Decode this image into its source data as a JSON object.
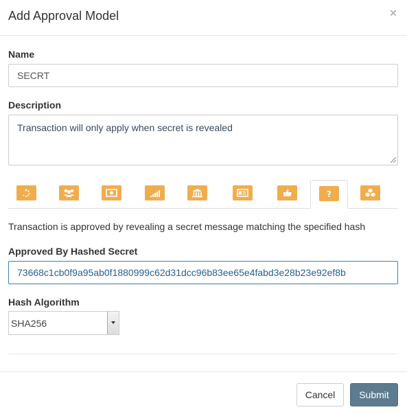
{
  "modal": {
    "title": "Add Approval Model",
    "close_glyph": "×"
  },
  "form": {
    "name_label": "Name",
    "name_value": "SECRT",
    "description_label": "Description",
    "description_value": "Transaction will only apply when secret is revealed",
    "approval_tabs": [
      {
        "icon": "spinner-icon",
        "active": false
      },
      {
        "icon": "users-icon",
        "active": false
      },
      {
        "icon": "money-icon",
        "active": false
      },
      {
        "icon": "signal-icon",
        "active": false
      },
      {
        "icon": "bank-icon",
        "active": false
      },
      {
        "icon": "id-card-icon",
        "active": false
      },
      {
        "icon": "thumbs-up-icon",
        "active": false
      },
      {
        "icon": "question-icon",
        "active": true
      },
      {
        "icon": "cubes-icon",
        "active": false
      }
    ],
    "tab_description": "Transaction is approved by revealing a secret message matching the specified hash",
    "hashed_secret_label": "Approved By Hashed Secret",
    "hashed_secret_value": "73668c1cb0f9a95ab0f1880999c62d31dcc96b83ee65e4fabd3e28b23e92ef8b",
    "hash_algorithm_label": "Hash Algorithm",
    "hash_algorithm_value": "SHA256"
  },
  "footer": {
    "cancel_label": "Cancel",
    "submit_label": "Submit"
  },
  "colors": {
    "tab_orange": "#f0ad4e",
    "submit_bg": "#5d7b8f",
    "focus_border": "#3b7eb8"
  }
}
